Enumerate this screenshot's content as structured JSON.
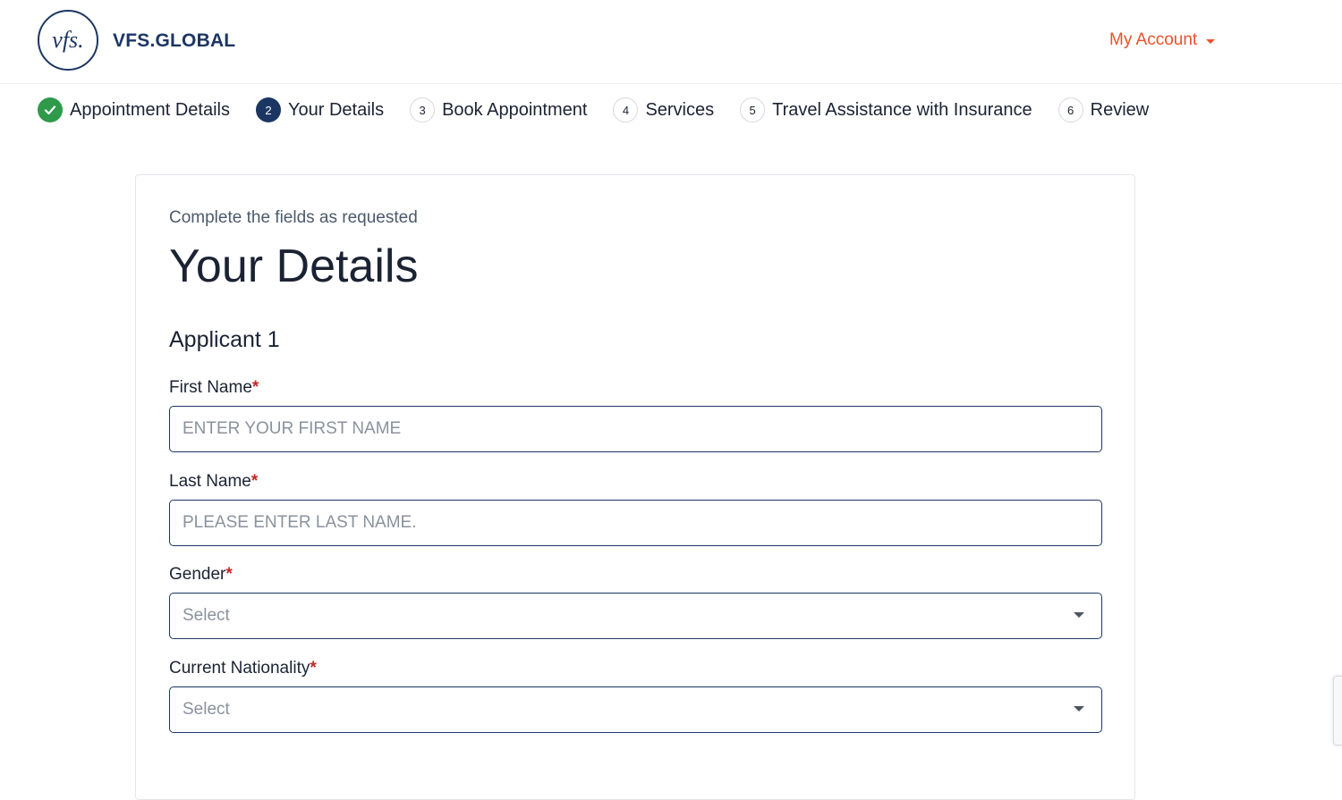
{
  "header": {
    "logo_mark": "vfs.",
    "logo_text": "VFS.GLOBAL",
    "account_label": "My Account"
  },
  "stepper": {
    "steps": [
      {
        "number": "",
        "label": "Appointment Details",
        "state": "done"
      },
      {
        "number": "2",
        "label": "Your Details",
        "state": "active"
      },
      {
        "number": "3",
        "label": "Book Appointment",
        "state": "pending"
      },
      {
        "number": "4",
        "label": "Services",
        "state": "pending"
      },
      {
        "number": "5",
        "label": "Travel Assistance with Insurance",
        "state": "pending"
      },
      {
        "number": "6",
        "label": "Review",
        "state": "pending"
      }
    ]
  },
  "form": {
    "subtitle": "Complete the fields as requested",
    "title": "Your Details",
    "applicant_heading": "Applicant 1",
    "required_marker": "*",
    "first_name": {
      "label": "First Name",
      "placeholder": "ENTER YOUR FIRST NAME",
      "value": ""
    },
    "last_name": {
      "label": "Last Name",
      "placeholder": "PLEASE ENTER LAST NAME.",
      "value": ""
    },
    "gender": {
      "label": "Gender",
      "selected": "Select"
    },
    "nationality": {
      "label": "Current Nationality",
      "selected": "Select"
    }
  },
  "colors": {
    "brand_navy": "#1c3664",
    "accent_orange": "#e8532b",
    "done_green": "#2f9a4a",
    "required_red": "#c62828"
  }
}
